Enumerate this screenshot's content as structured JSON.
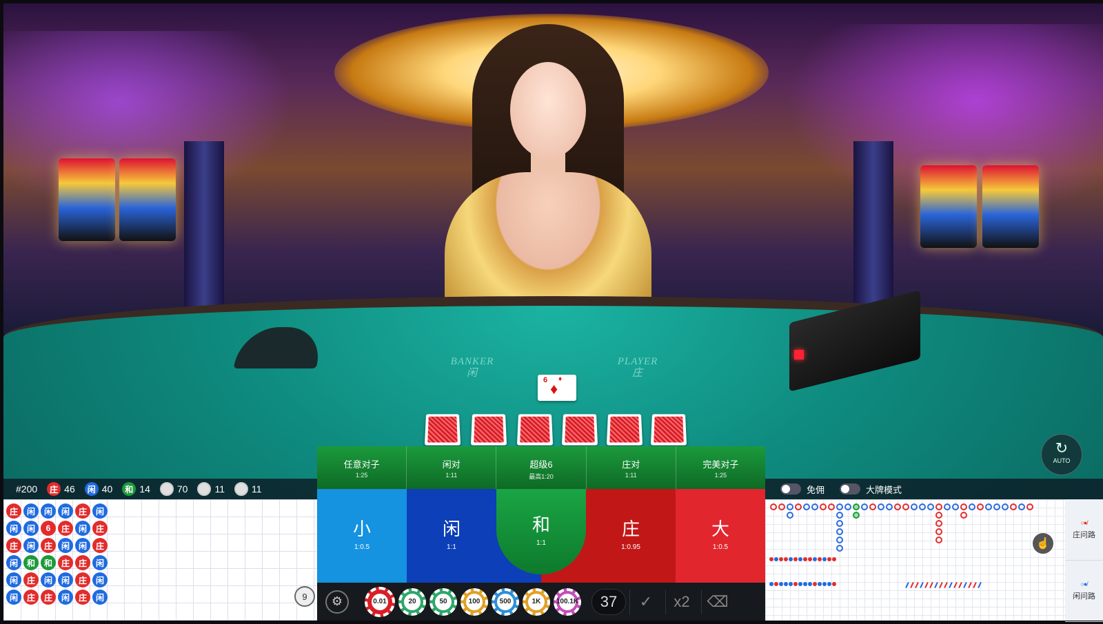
{
  "table": {
    "banker_label_en": "BANKER",
    "banker_label_cn": "闲",
    "player_label_en": "PLAYER",
    "player_label_cn": "庄",
    "face_card": {
      "rank": "6",
      "suit": "♦"
    },
    "auto_label": "AUTO"
  },
  "stats": {
    "round": "#200",
    "banker": {
      "label": "庄",
      "count": "46"
    },
    "player": {
      "label": "闲",
      "count": "40"
    },
    "tie": {
      "label": "和",
      "count": "14"
    },
    "other1": "70",
    "other2": "11",
    "other3": "11"
  },
  "bead_road": [
    [
      "庄",
      "闲",
      "闲",
      "闲",
      "庄",
      "闲"
    ],
    [
      "闲",
      "闲",
      "6",
      "庄",
      "闲",
      "庄"
    ],
    [
      "庄",
      "闲",
      "庄",
      "闲",
      "闲",
      "庄"
    ],
    [
      "闲",
      "和",
      "和",
      "庄",
      "庄",
      "闲"
    ],
    [
      "闲",
      "庄",
      "闲",
      "闲",
      "庄",
      "闲"
    ],
    [
      "闲",
      "庄",
      "庄",
      "闲",
      "庄",
      "闲"
    ]
  ],
  "shoe_count": "9",
  "side_bets": [
    {
      "name": "任意对子",
      "odds": "1:25"
    },
    {
      "name": "闲对",
      "odds": "1:11"
    },
    {
      "name": "超级6",
      "odds": "最高1:20"
    },
    {
      "name": "庄对",
      "odds": "1:11"
    },
    {
      "name": "完美对子",
      "odds": "1:25"
    }
  ],
  "main_bets": {
    "small": {
      "name": "小",
      "odds": "1:0.5"
    },
    "player": {
      "name": "闲",
      "odds": "1:1"
    },
    "tie": {
      "name": "和",
      "odds": "1:1"
    },
    "banker": {
      "name": "庄",
      "odds": "1:0.95"
    },
    "big": {
      "name": "大",
      "odds": "1:0.5"
    }
  },
  "chips": [
    {
      "label": "0.01",
      "color": "#d91e26"
    },
    {
      "label": "20",
      "color": "#2fa66a"
    },
    {
      "label": "50",
      "color": "#2fa66a"
    },
    {
      "label": "100",
      "color": "#e0a126"
    },
    {
      "label": "500",
      "color": "#2d8fd6"
    },
    {
      "label": "1K",
      "color": "#e0a126"
    },
    {
      "label": "100.1K",
      "color": "#c24fb8"
    }
  ],
  "bet_count": "37",
  "controls": {
    "confirm": "✓",
    "double": "x2",
    "undo": "⌫"
  },
  "toggles": [
    {
      "label": "免佣"
    },
    {
      "label": "大牌模式"
    }
  ],
  "side_tabs": [
    {
      "label": "庄问路"
    },
    {
      "label": "闲问路"
    }
  ]
}
